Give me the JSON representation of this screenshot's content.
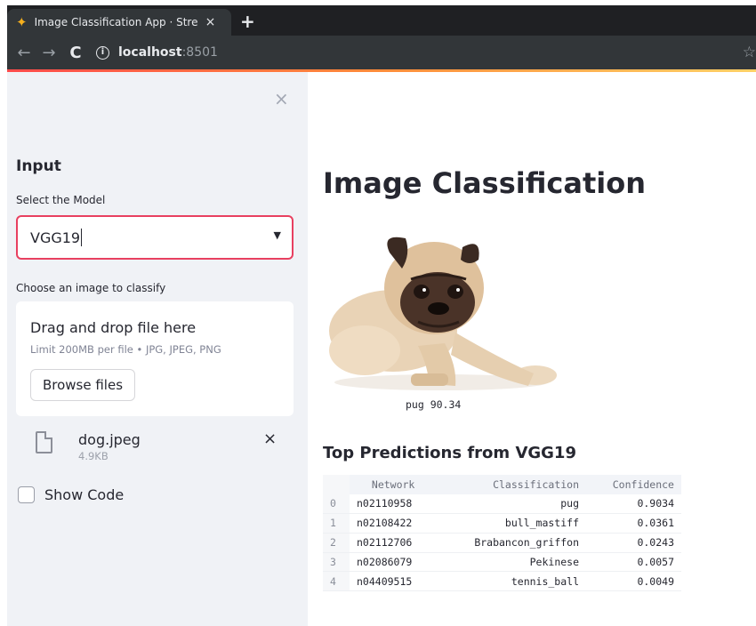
{
  "browser": {
    "tab_title": "Image Classification App · Stre",
    "tab_close": "×",
    "new_tab": "+",
    "url_host": "localhost",
    "url_port": ":8501",
    "back": "←",
    "forward": "→",
    "reload": "C",
    "info": "i",
    "star": "☆"
  },
  "sidebar": {
    "close": "×",
    "heading": "Input",
    "model_label": "Select the Model",
    "model_value": "VGG19",
    "select_arrow": "▼",
    "upload_label": "Choose an image to classify",
    "dropzone_title": "Drag and drop file here",
    "dropzone_limit": "Limit 200MB per file • JPG, JPEG, PNG",
    "browse_button": "Browse files",
    "file_name": "dog.jpeg",
    "file_size": "4.9KB",
    "file_remove": "×",
    "show_code_label": "Show Code"
  },
  "main": {
    "title": "Image Classification",
    "image_caption": "pug 90.34",
    "predictions_title": "Top Predictions from VGG19",
    "table": {
      "headers": [
        "Network",
        "Classification",
        "Confidence"
      ],
      "rows": [
        {
          "index": "0",
          "network": "n02110958",
          "classification": "pug",
          "confidence": "0.9034"
        },
        {
          "index": "1",
          "network": "n02108422",
          "classification": "bull_mastiff",
          "confidence": "0.0361"
        },
        {
          "index": "2",
          "network": "n02112706",
          "classification": "Brabancon_griffon",
          "confidence": "0.0243"
        },
        {
          "index": "3",
          "network": "n02086079",
          "classification": "Pekinese",
          "confidence": "0.0057"
        },
        {
          "index": "4",
          "network": "n04409515",
          "classification": "tennis_ball",
          "confidence": "0.0049"
        }
      ]
    }
  },
  "colors": {
    "accent": "#ff4b4b",
    "sidebar_bg": "#f0f2f6",
    "select_border": "#e84060"
  }
}
